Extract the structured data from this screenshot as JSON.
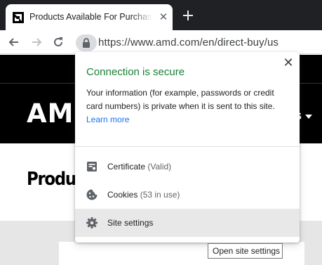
{
  "tab": {
    "title": "Products Available For Purchase",
    "close_glyph": "✕",
    "favicon_icon": "amd-logo-icon",
    "new_tab_icon": "plus-icon"
  },
  "toolbar": {
    "back_icon": "arrow-left-icon",
    "forward_icon": "arrow-right-icon",
    "reload_icon": "reload-icon",
    "site_info_icon": "lock-icon",
    "url": "https://www.amd.com/en/direct-buy/us"
  },
  "page": {
    "logo_text": "AM",
    "nav_partial": "s",
    "heading_partial": "Produc"
  },
  "popup": {
    "title": "Connection is secure",
    "title_color": "#188038",
    "description": "Your information (for example, passwords or credit card numbers) is private when it is sent to this site.",
    "learn_more": "Learn more",
    "close_glyph": "✕",
    "items": [
      {
        "label": "Certificate",
        "extra": "(Valid)",
        "icon": "certificate-icon"
      },
      {
        "label": "Cookies",
        "extra": "(53 in use)",
        "icon": "cookie-icon"
      },
      {
        "label": "Site settings",
        "extra": "",
        "icon": "gear-icon",
        "hovered": true
      }
    ]
  },
  "tooltip": "Open site settings"
}
